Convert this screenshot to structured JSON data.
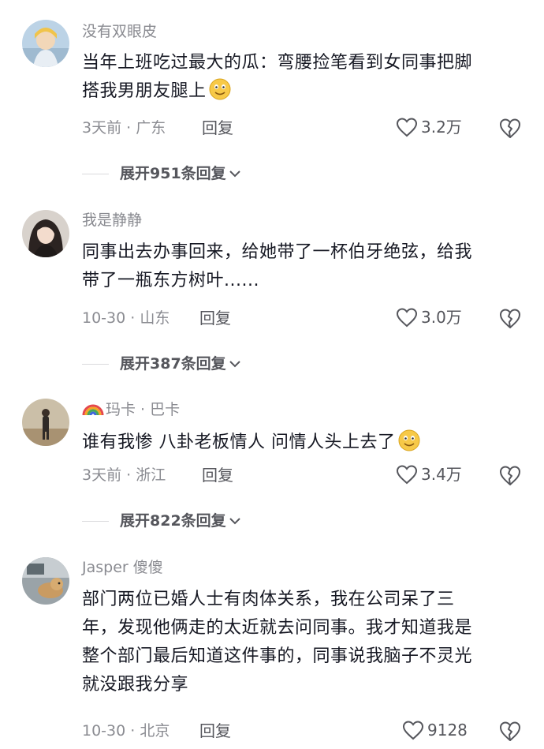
{
  "comments": [
    {
      "username": "没有双眼皮",
      "text_line1": "当年上班吃过最大的瓜：弯腰捡笔看到女同事把脚",
      "text_line2": "搭我男朋友腿上",
      "time": "3天前",
      "location": "广东",
      "reply_label": "回复",
      "likes": "3.2万",
      "expand_label": "展开951条回复"
    },
    {
      "username": "我是静静",
      "text_line1": "同事出去办事回来，给她带了一杯伯牙绝弦，给我",
      "text_line2": "带了一瓶东方树叶......",
      "time": "10-30",
      "location": "山东",
      "reply_label": "回复",
      "likes": "3.0万",
      "expand_label": "展开387条回复"
    },
    {
      "username": "玛卡 · 巴卡",
      "text_line1": "谁有我惨 八卦老板情人 问情人头上去了",
      "time": "3天前",
      "location": "浙江",
      "reply_label": "回复",
      "likes": "3.4万",
      "expand_label": "展开822条回复"
    },
    {
      "username": "Jasper 傻傻",
      "text_line1": "部门两位已婚人士有肉体关系，我在公司呆了三",
      "text_line2": "年，发现他俩走的太近就去问同事。我才知道我是",
      "text_line3": "整个部门最后知道这件事的，同事说我脑子不灵光",
      "text_line4": "就没跟我分享",
      "time": "10-30",
      "location": "北京",
      "reply_label": "回复",
      "likes": "9128"
    }
  ],
  "meta_separator": " · ",
  "colors": {
    "primary_text": "#161823",
    "secondary_text": "#8a8b91",
    "action_text": "#55565c",
    "background": "#ffffff"
  },
  "icons": {
    "like": "heart-outline-icon",
    "dislike": "broken-heart-icon",
    "expand": "chevron-down-icon",
    "emoji": "smiley-emoji-icon",
    "rainbow": "rainbow-emoji-icon"
  }
}
